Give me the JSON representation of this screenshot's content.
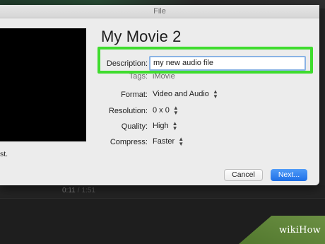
{
  "window": {
    "title": "File"
  },
  "preview": {
    "truncated_text": "st."
  },
  "movie": {
    "title": "My Movie 2"
  },
  "fields": {
    "description": {
      "label": "Description:",
      "value": "my new audio file"
    },
    "tags": {
      "label": "Tags:",
      "value": "iMovie"
    },
    "format": {
      "label": "Format:",
      "value": "Video and Audio"
    },
    "resolution": {
      "label": "Resolution:",
      "value": "0 x 0"
    },
    "quality": {
      "label": "Quality:",
      "value": "High"
    },
    "compress": {
      "label": "Compress:",
      "value": "Faster"
    }
  },
  "buttons": {
    "cancel": "Cancel",
    "next": "Next..."
  },
  "timeline": {
    "current": "0:11",
    "separator": "/",
    "total": "1:51"
  },
  "highlight_color": "#3fdc2e",
  "watermark": {
    "text": "wikiHow"
  }
}
